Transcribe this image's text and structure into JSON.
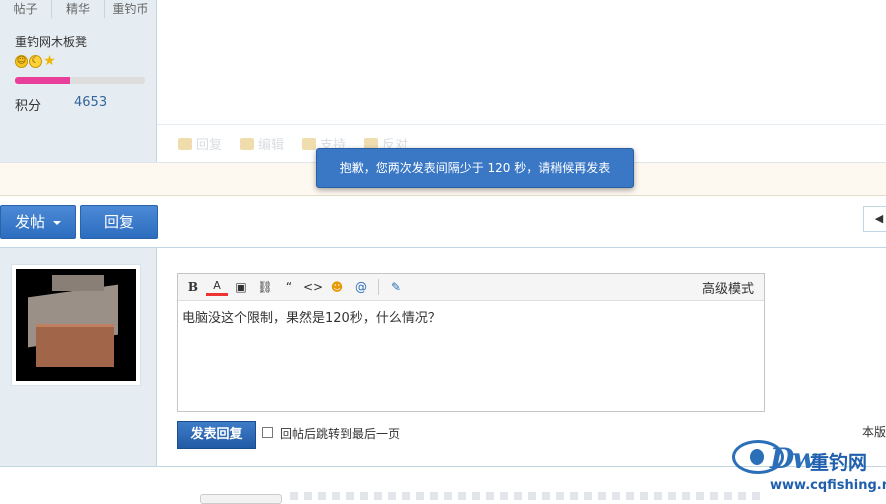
{
  "profile": {
    "stats": [
      "帖子",
      "精华",
      "重钓币"
    ],
    "username": "重钓网木板凳",
    "level_progress": 0.42,
    "score_label": "积分",
    "score_value": "4653"
  },
  "post_actions": [
    "回复",
    "编辑",
    "支持",
    "反对"
  ],
  "toast": "抱歉，您两次发表间隔少于 120 秒，请稍候再发表",
  "toolbar": {
    "post_label": "发帖",
    "reply_label": "回复"
  },
  "editor": {
    "advanced_mode": "高级模式",
    "content": "电脑没这个限制，果然是120秒，什么情况？",
    "tools": [
      "B",
      "A",
      "image",
      "link",
      "“",
      "<>",
      "emoji",
      "@",
      "attach"
    ]
  },
  "submit_label": "发表回复",
  "jump_label": "回帖后跳转到最后一页",
  "right_cut_text": "本版",
  "watermark": {
    "brand": "Dw",
    "name": "重钓网",
    "url": "www.cqfishing.net"
  },
  "colors": {
    "primary": "#2d6dbf",
    "toast": "#3a78c6",
    "progress": "#e8409a"
  }
}
